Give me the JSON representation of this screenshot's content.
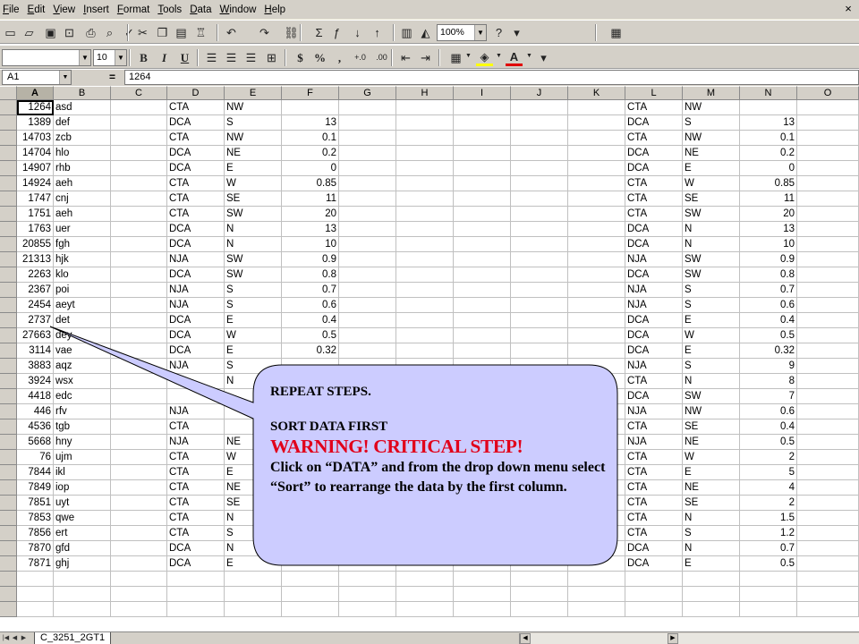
{
  "menu": [
    "File",
    "Edit",
    "View",
    "Insert",
    "Format",
    "Tools",
    "Data",
    "Window",
    "Help"
  ],
  "menu_close": "×",
  "standard_toolbar": {
    "zoom": "100%",
    "icons": [
      "new-icon",
      "open-icon",
      "save-icon",
      "permission-icon",
      "print-icon",
      "print-preview-icon",
      "spelling-icon",
      "cut-icon",
      "copy-icon",
      "paste-icon",
      "format-painter-icon",
      "undo-icon",
      "redo-icon",
      "hyperlink-icon",
      "autosum-icon",
      "insert-function-icon",
      "sort-ascending-icon",
      "sort-descending-icon",
      "chart-wizard-icon",
      "drawing-icon",
      "zoom-dropdown",
      "help-icon",
      "toolbar-options-icon"
    ]
  },
  "format_toolbar": {
    "font": "",
    "size": "10",
    "buttons": {
      "bold": "B",
      "italic": "I",
      "underline": "U",
      "currency": "$",
      "percent": "%",
      "comma": ",",
      "inc_decimal": "+.0",
      "dec_decimal": ".00"
    }
  },
  "formula_bar": {
    "namebox": "A1",
    "equals": "=",
    "formula": "1264"
  },
  "columns": [
    "A",
    "B",
    "C",
    "D",
    "E",
    "F",
    "G",
    "H",
    "I",
    "J",
    "K",
    "L",
    "M",
    "N",
    "O"
  ],
  "rows": [
    [
      "1264",
      "asd",
      "",
      "CTA",
      "NW",
      "",
      "",
      "",
      "",
      "",
      "",
      "CTA",
      "NW",
      "",
      ""
    ],
    [
      "1389",
      "def",
      "",
      "DCA",
      "S",
      "13",
      "",
      "",
      "",
      "",
      "",
      "DCA",
      "S",
      "13",
      ""
    ],
    [
      "14703",
      "zcb",
      "",
      "CTA",
      "NW",
      "0.1",
      "",
      "",
      "",
      "",
      "",
      "CTA",
      "NW",
      "0.1",
      ""
    ],
    [
      "14704",
      "hlo",
      "",
      "DCA",
      "NE",
      "0.2",
      "",
      "",
      "",
      "",
      "",
      "DCA",
      "NE",
      "0.2",
      ""
    ],
    [
      "14907",
      "rhb",
      "",
      "DCA",
      "E",
      "0",
      "",
      "",
      "",
      "",
      "",
      "DCA",
      "E",
      "0",
      ""
    ],
    [
      "14924",
      "aeh",
      "",
      "CTA",
      "W",
      "0.85",
      "",
      "",
      "",
      "",
      "",
      "CTA",
      "W",
      "0.85",
      ""
    ],
    [
      "1747",
      "cnj",
      "",
      "CTA",
      "SE",
      "11",
      "",
      "",
      "",
      "",
      "",
      "CTA",
      "SE",
      "11",
      ""
    ],
    [
      "1751",
      "aeh",
      "",
      "CTA",
      "SW",
      "20",
      "",
      "",
      "",
      "",
      "",
      "CTA",
      "SW",
      "20",
      ""
    ],
    [
      "1763",
      "uer",
      "",
      "DCA",
      "N",
      "13",
      "",
      "",
      "",
      "",
      "",
      "DCA",
      "N",
      "13",
      ""
    ],
    [
      "20855",
      "fgh",
      "",
      "DCA",
      "N",
      "10",
      "",
      "",
      "",
      "",
      "",
      "DCA",
      "N",
      "10",
      ""
    ],
    [
      "21313",
      "hjk",
      "",
      "NJA",
      "SW",
      "0.9",
      "",
      "",
      "",
      "",
      "",
      "NJA",
      "SW",
      "0.9",
      ""
    ],
    [
      "2263",
      "klo",
      "",
      "DCA",
      "SW",
      "0.8",
      "",
      "",
      "",
      "",
      "",
      "DCA",
      "SW",
      "0.8",
      ""
    ],
    [
      "2367",
      "poi",
      "",
      "NJA",
      "S",
      "0.7",
      "",
      "",
      "",
      "",
      "",
      "NJA",
      "S",
      "0.7",
      ""
    ],
    [
      "2454",
      "aeyt",
      "",
      "NJA",
      "S",
      "0.6",
      "",
      "",
      "",
      "",
      "",
      "NJA",
      "S",
      "0.6",
      ""
    ],
    [
      "2737",
      "det",
      "",
      "DCA",
      "E",
      "0.4",
      "",
      "",
      "",
      "",
      "",
      "DCA",
      "E",
      "0.4",
      ""
    ],
    [
      "27663",
      "dey",
      "",
      "DCA",
      "W",
      "0.5",
      "",
      "",
      "",
      "",
      "",
      "DCA",
      "W",
      "0.5",
      ""
    ],
    [
      "3114",
      "vae",
      "",
      "DCA",
      "E",
      "0.32",
      "",
      "",
      "",
      "",
      "",
      "DCA",
      "E",
      "0.32",
      ""
    ],
    [
      "3883",
      "aqz",
      "",
      "NJA",
      "S",
      "",
      "",
      "",
      "",
      "",
      "",
      "NJA",
      "S",
      "9",
      ""
    ],
    [
      "3924",
      "wsx",
      "",
      "",
      "N",
      "",
      "",
      "",
      "",
      "",
      "",
      "CTA",
      "N",
      "8",
      ""
    ],
    [
      "4418",
      "edc",
      "",
      "",
      "",
      "",
      "",
      "",
      "",
      "",
      "",
      "DCA",
      "SW",
      "7",
      ""
    ],
    [
      "446",
      "rfv",
      "",
      "NJA",
      "",
      "",
      "",
      "",
      "",
      "",
      "",
      "NJA",
      "NW",
      "0.6",
      ""
    ],
    [
      "4536",
      "tgb",
      "",
      "CTA",
      "",
      "",
      "",
      "",
      "",
      "",
      "",
      "CTA",
      "SE",
      "0.4",
      ""
    ],
    [
      "5668",
      "hny",
      "",
      "NJA",
      "NE",
      "",
      "",
      "",
      "",
      "",
      "",
      "NJA",
      "NE",
      "0.5",
      ""
    ],
    [
      "76",
      "ujm",
      "",
      "CTA",
      "W",
      "",
      "",
      "",
      "",
      "",
      "",
      "CTA",
      "W",
      "2",
      ""
    ],
    [
      "7844",
      "ikl",
      "",
      "CTA",
      "E",
      "",
      "",
      "",
      "",
      "",
      "",
      "CTA",
      "E",
      "5",
      ""
    ],
    [
      "7849",
      "iop",
      "",
      "CTA",
      "NE",
      "",
      "",
      "",
      "",
      "",
      "",
      "CTA",
      "NE",
      "4",
      ""
    ],
    [
      "7851",
      "uyt",
      "",
      "CTA",
      "SE",
      "",
      "",
      "",
      "",
      "",
      "",
      "CTA",
      "SE",
      "2",
      ""
    ],
    [
      "7853",
      "qwe",
      "",
      "CTA",
      "N",
      "",
      "",
      "",
      "",
      "",
      "",
      "CTA",
      "N",
      "1.5",
      ""
    ],
    [
      "7856",
      "ert",
      "",
      "CTA",
      "S",
      "",
      "",
      "",
      "",
      "",
      "",
      "CTA",
      "S",
      "1.2",
      ""
    ],
    [
      "7870",
      "gfd",
      "",
      "DCA",
      "N",
      "",
      "",
      "",
      "",
      "",
      "",
      "DCA",
      "N",
      "0.7",
      ""
    ],
    [
      "7871",
      "ghj",
      "",
      "DCA",
      "E",
      "",
      "",
      "",
      "",
      "",
      "",
      "DCA",
      "E",
      "0.5",
      ""
    ],
    [
      "",
      "",
      "",
      "",
      "",
      "",
      "",
      "",
      "",
      "",
      "",
      "",
      "",
      "",
      ""
    ],
    [
      "",
      "",
      "",
      "",
      "",
      "",
      "",
      "",
      "",
      "",
      "",
      "",
      "",
      "",
      ""
    ],
    [
      "",
      "",
      "",
      "",
      "",
      "",
      "",
      "",
      "",
      "",
      "",
      "",
      "",
      "",
      ""
    ]
  ],
  "numeric_columns": [
    0,
    5,
    13
  ],
  "callout": {
    "line1": "REPEAT STEPS.",
    "line2": "SORT DATA FIRST",
    "warning": "WARNING! CRITICAL STEP!",
    "body": "Click on “DATA” and from the drop down menu select  “Sort” to rearrange the data by the first column.",
    "fill": "#ccccff",
    "border": "#000000",
    "warning_color": "#e1001a"
  },
  "sheet_tab": "C_3251_2GT1"
}
